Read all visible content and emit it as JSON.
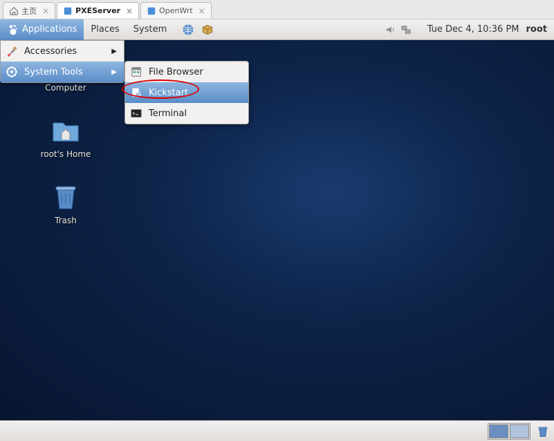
{
  "browser_tabs": [
    {
      "label": "主页",
      "active": false
    },
    {
      "label": "PXEServer",
      "active": true
    },
    {
      "label": "OpenWrt",
      "active": false
    }
  ],
  "panel": {
    "applications": "Applications",
    "places": "Places",
    "system": "System",
    "clock": "Tue Dec  4, 10:36 PM",
    "user": "root"
  },
  "apps_menu": [
    {
      "label": "Accessories",
      "icon": "accessories-icon",
      "highlight": false,
      "has_sub": true
    },
    {
      "label": "System Tools",
      "icon": "systemtools-icon",
      "highlight": true,
      "has_sub": true
    }
  ],
  "submenu": [
    {
      "label": "File Browser",
      "icon": "filebrowser-icon",
      "highlight": false
    },
    {
      "label": "Kickstart",
      "icon": "kickstart-icon",
      "highlight": true
    },
    {
      "label": "Terminal",
      "icon": "terminal-icon",
      "highlight": false
    }
  ],
  "desktop_icons": [
    {
      "label": "Computer",
      "icon": "computer-icon"
    },
    {
      "label": "root's Home",
      "icon": "home-icon"
    },
    {
      "label": "Trash",
      "icon": "trash-icon"
    }
  ]
}
